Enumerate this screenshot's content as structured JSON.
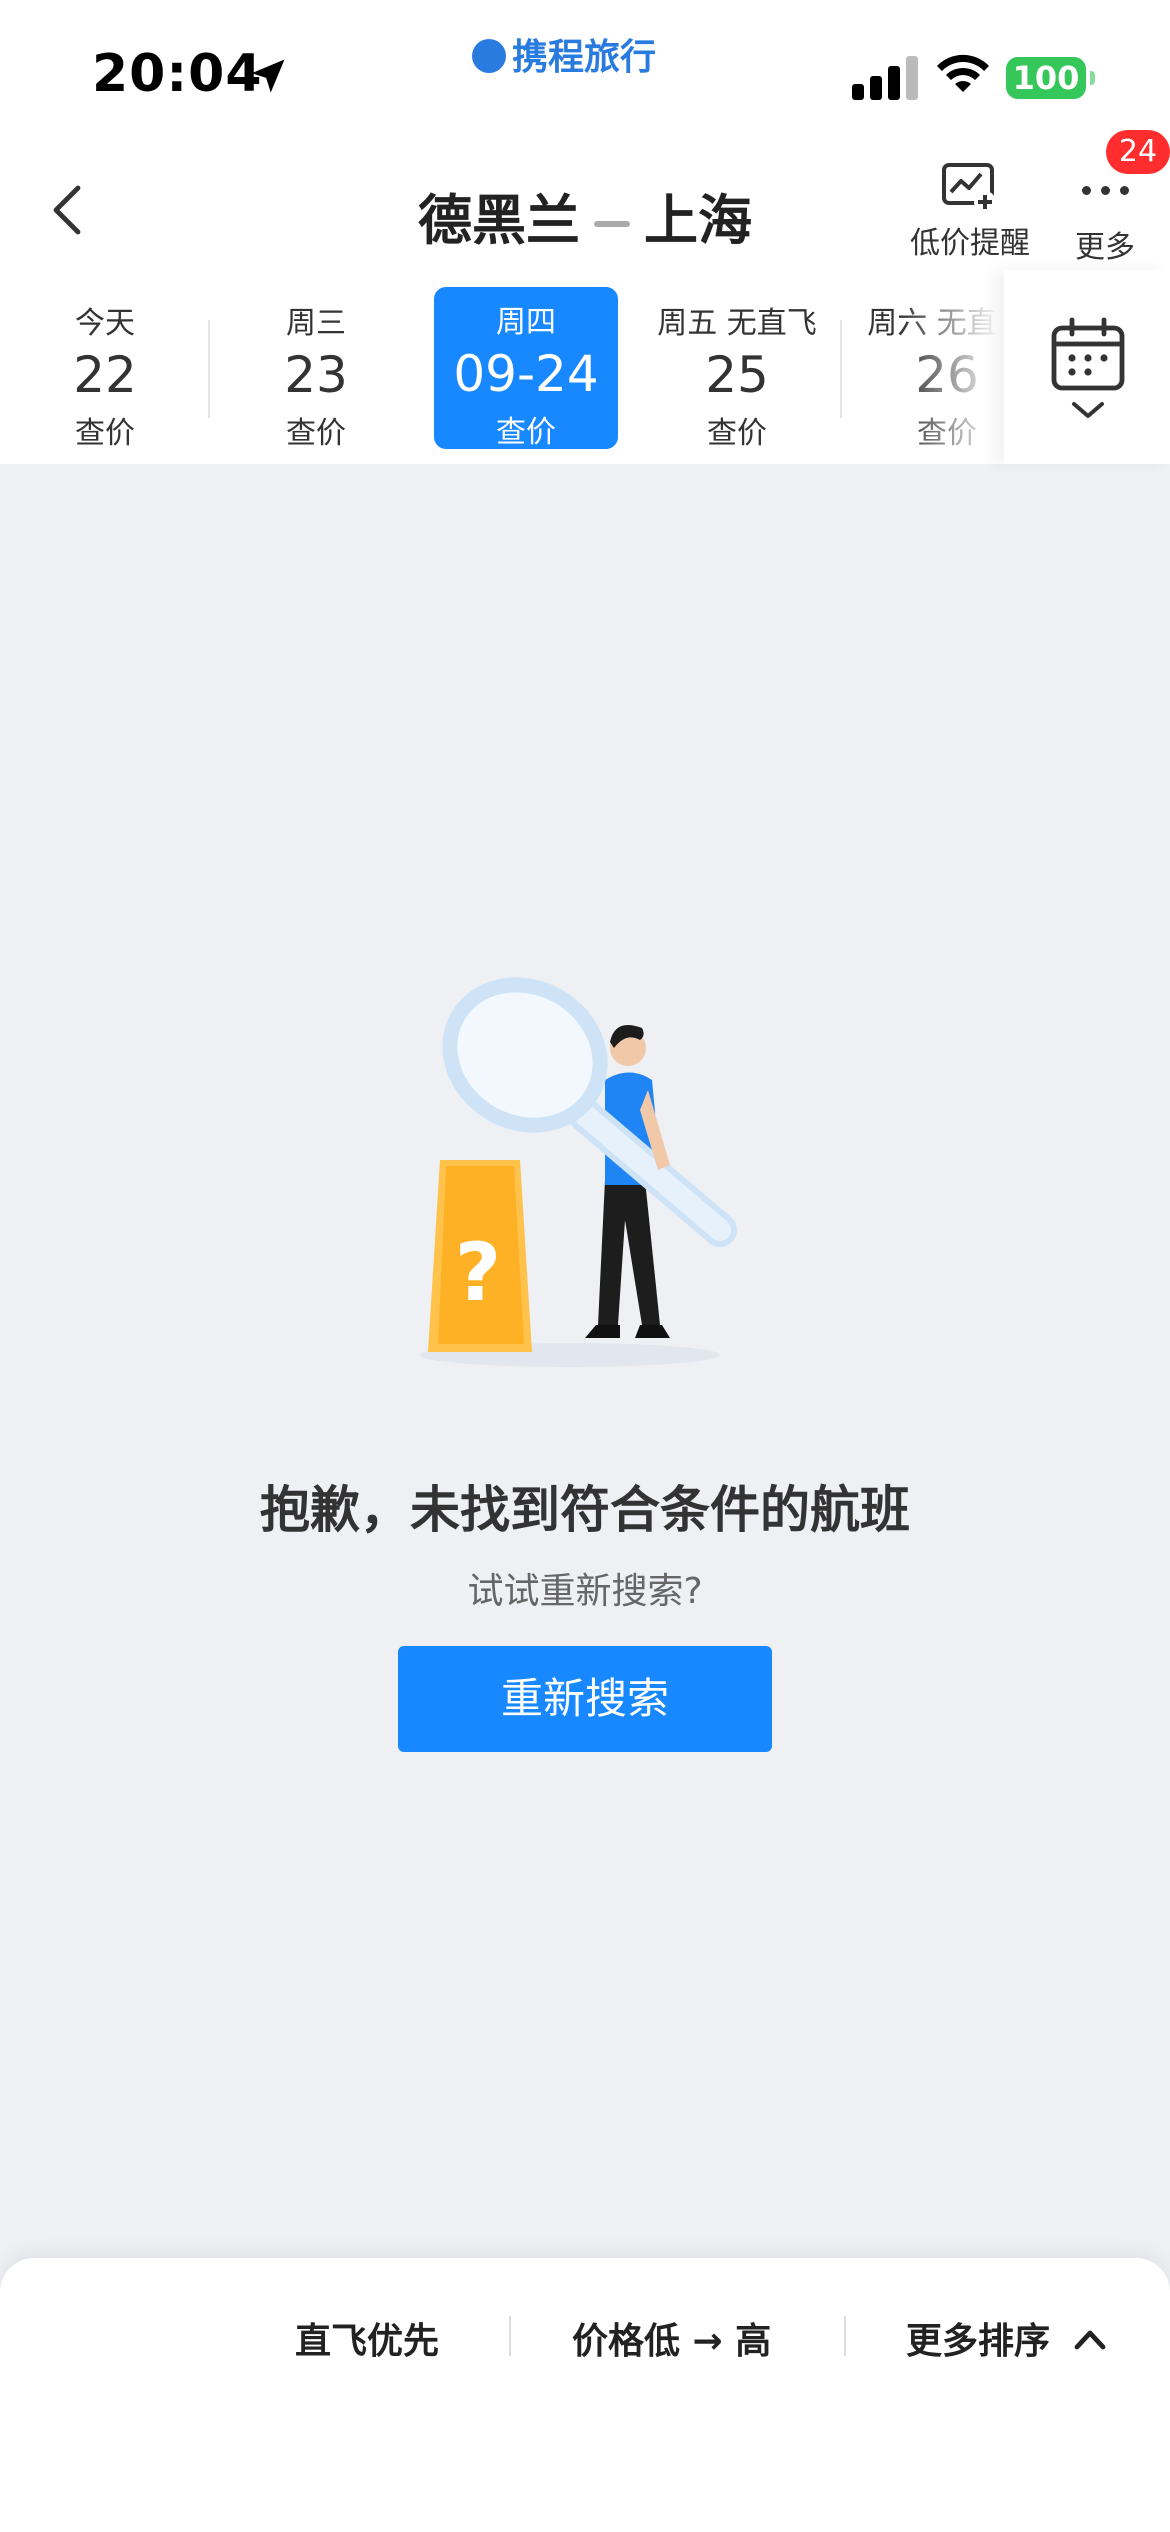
{
  "status_bar": {
    "time": "20:04",
    "carrier": "携程旅行",
    "battery": "100"
  },
  "header": {
    "origin": "德黑兰",
    "destination": "上海",
    "price_alert_label": "低价提醒",
    "more_label": "更多",
    "more_badge": "24"
  },
  "dates": [
    {
      "weekday": "今天",
      "day": "22",
      "price": "查价"
    },
    {
      "weekday": "周三",
      "day": "23",
      "price": "查价"
    },
    {
      "weekday": "周四",
      "day": "09-24",
      "price": "查价",
      "selected": true
    },
    {
      "weekday": "周五 无直飞",
      "day": "25",
      "price": "查价"
    },
    {
      "weekday": "周六 无直飞",
      "day": "26",
      "price": "查价"
    }
  ],
  "empty_state": {
    "title": "抱歉，未找到符合条件的航班",
    "subtitle": "试试重新搜索?",
    "button": "重新搜索"
  },
  "sort_bar": {
    "direct_first": "直飞优先",
    "price_low_high": "价格低 → 高",
    "more_sort": "更多排序"
  },
  "colors": {
    "accent": "#1788ff",
    "badge": "#ff2d2d",
    "battery": "#35c759",
    "background": "#eef0f4"
  },
  "icons": [
    "location-arrow-icon",
    "signal-icon",
    "wifi-icon",
    "back-arrow-icon",
    "price-alert-chart-icon",
    "more-dots-icon",
    "calendar-icon",
    "chevron-down-icon",
    "chevron-up-icon"
  ]
}
